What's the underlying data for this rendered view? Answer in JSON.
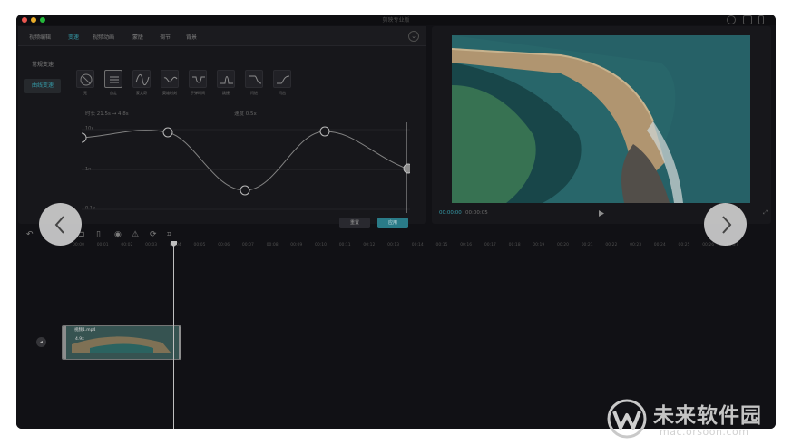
{
  "window": {
    "title": "剪映专业版"
  },
  "tabs": [
    "视频编辑",
    "变速",
    "视频动画",
    "蒙版",
    "调节",
    "背景"
  ],
  "active_tab_index": 1,
  "side_menu": [
    "常规变速",
    "曲线变速"
  ],
  "active_side_index": 1,
  "presets": [
    "无",
    "自定",
    "蒙太奇",
    "英雄时刻",
    "子弹时间",
    "跳接",
    "闪进",
    "闪出"
  ],
  "info": {
    "duration": "时长 21.5s → 4.8s",
    "speed": "速度 0.5x"
  },
  "curve_axis": [
    "10x",
    "1x",
    "0.1x"
  ],
  "buttons": {
    "reset": "重置",
    "apply": "应用"
  },
  "player": {
    "current_time": "00:00:00",
    "total_time": "00:00:05"
  },
  "ruler_ticks": [
    "00:00",
    "00:01",
    "00:02",
    "00:03",
    "00:04",
    "00:05",
    "00:06",
    "00:07",
    "00:08",
    "00:09",
    "00:10",
    "00:11",
    "00:12",
    "00:13",
    "00:14",
    "00:15",
    "00:16",
    "00:17",
    "00:18",
    "00:19",
    "00:20",
    "00:21",
    "00:22",
    "00:23",
    "00:24",
    "00:25",
    "00:26",
    "00:27"
  ],
  "clip": {
    "name": "视频1.mp4",
    "speed": "4.9x"
  },
  "watermark": {
    "title": "未来软件园",
    "url": "mac.orsoon.com"
  },
  "colors": {
    "accent": "#3aa7b6",
    "background": "#131317",
    "panel": "#1a1a1e"
  }
}
